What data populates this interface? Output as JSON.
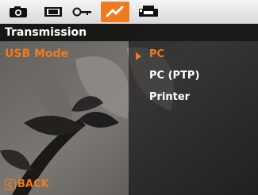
{
  "tabs": [
    {
      "icon": "camera-icon"
    },
    {
      "icon": "video-icon"
    },
    {
      "icon": "key-icon"
    },
    {
      "icon": "wrench-icon",
      "active": true
    },
    {
      "icon": "printer-icon"
    }
  ],
  "colors": {
    "accent": "#f07a1e",
    "text": "#ffffff"
  },
  "header": {
    "title": "Transmission"
  },
  "menu": {
    "item_label": "USB Mode"
  },
  "options": [
    {
      "label": "PC",
      "selected": true
    },
    {
      "label": "PC (PTP)"
    },
    {
      "label": "Printer"
    }
  ],
  "footer": {
    "back_label": "BACK"
  }
}
